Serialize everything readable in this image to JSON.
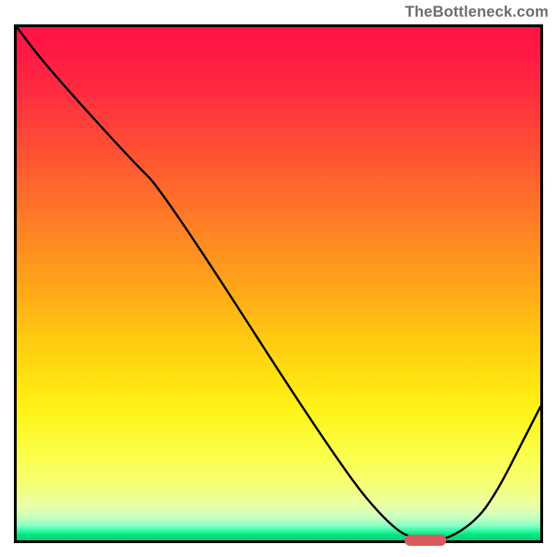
{
  "watermark": "TheBottleneck.com",
  "chart_data": {
    "type": "line",
    "title": "",
    "xlabel": "",
    "ylabel": "",
    "xlim": [
      0,
      100
    ],
    "ylim": [
      0,
      100
    ],
    "series": [
      {
        "name": "curve",
        "x": [
          0,
          6,
          22,
          28,
          62,
          72,
          77,
          82,
          88,
          92,
          96,
          100
        ],
        "values": [
          100,
          92,
          74,
          68,
          14,
          2,
          0,
          0,
          4,
          10,
          18,
          26
        ]
      }
    ],
    "marker": {
      "x_start": 74,
      "x_end": 82,
      "y": 0
    },
    "gradient_top_rgb": "#ff1345",
    "gradient_bottom_rgb": "#03d573"
  }
}
